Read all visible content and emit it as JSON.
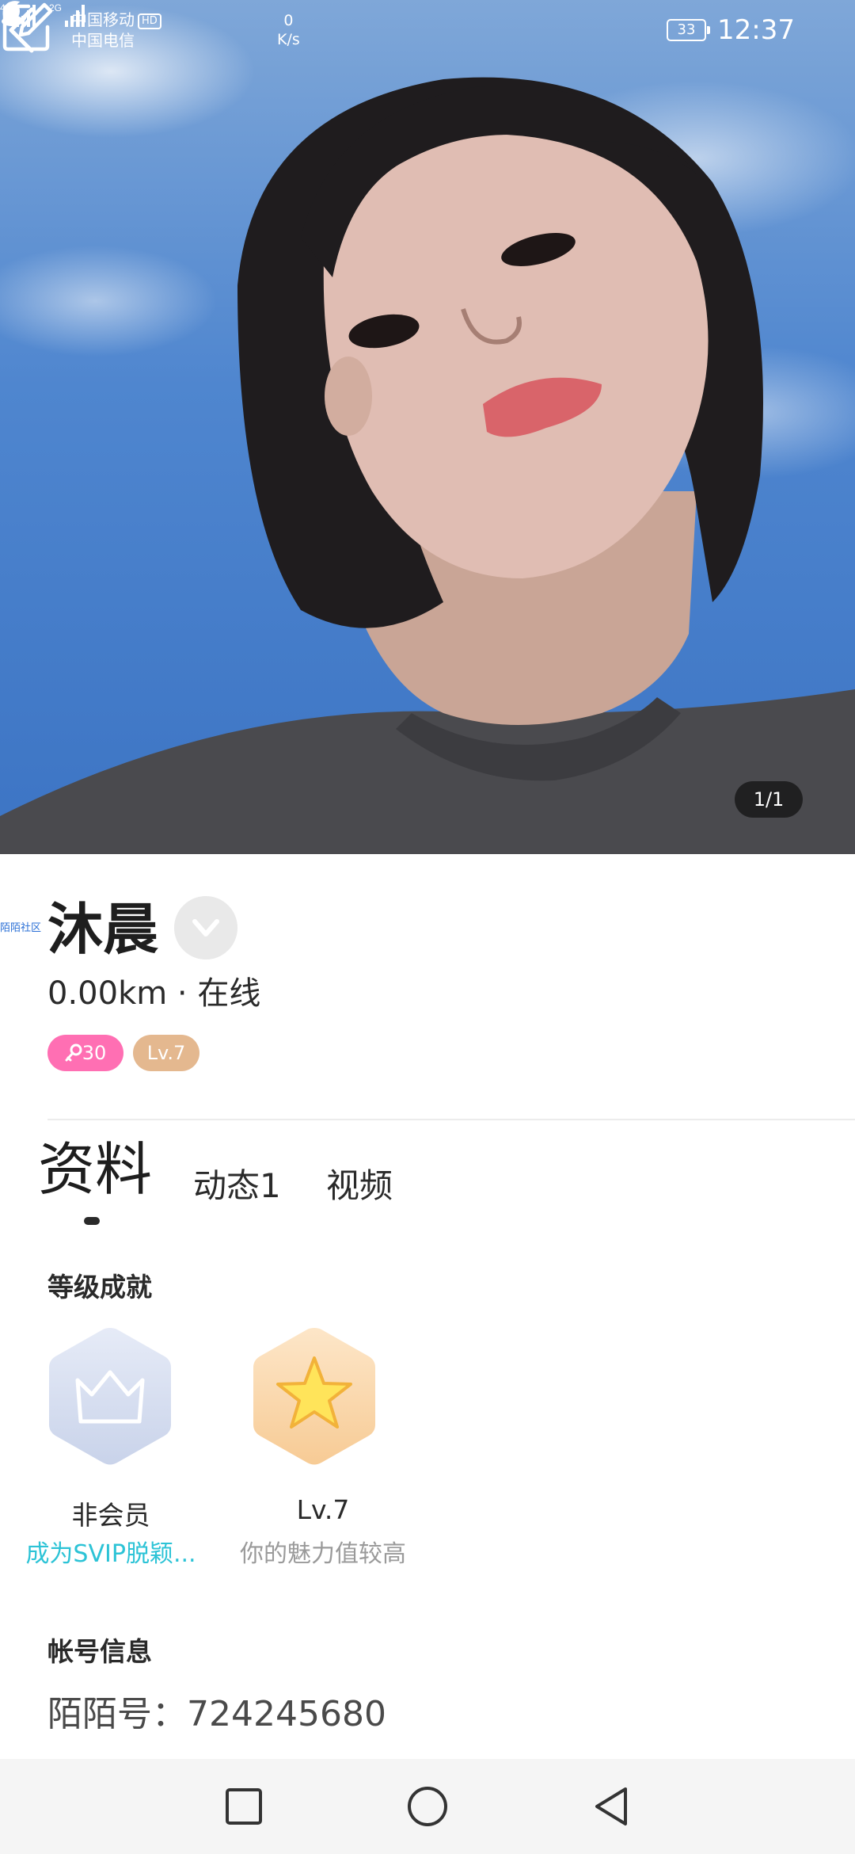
{
  "status_bar": {
    "carrier_1": "中国移动",
    "hd_badge": "HD",
    "carrier_2": "中国电信",
    "net_4g": "4G",
    "net_2g": "2G",
    "net_speed_value": "0",
    "net_speed_unit": "K/s",
    "battery": "33",
    "time": "12:37",
    "icons": [
      "signal-icon",
      "qq-icon",
      "moon-icon",
      "battery-icon"
    ]
  },
  "hero": {
    "photo_counter": "1/1",
    "icons": [
      "back-icon",
      "edit-icon"
    ]
  },
  "watermark": "陌陌社区",
  "profile": {
    "name": "沐晨",
    "distance_status": "0.00km · 在线",
    "fans_badge": "30",
    "level_badge": "Lv.7",
    "colors": {
      "fans_badge": "#ff6fb3",
      "level_badge": "#e4b88f"
    }
  },
  "tabs": [
    {
      "label": "资料",
      "active": true
    },
    {
      "label": "动态1",
      "active": false
    },
    {
      "label": "视频",
      "active": false
    }
  ],
  "achievements": {
    "title": "等级成就",
    "items": [
      {
        "title": "非会员",
        "desc": "成为SVIP脱颖...",
        "icon": "crown-icon",
        "desc_color": "#2cc3d6"
      },
      {
        "title": "Lv.7",
        "desc": "你的魅力值较高",
        "icon": "star-icon",
        "desc_color": "#9a9a9a"
      }
    ]
  },
  "account": {
    "title": "帐号信息",
    "id_text": "陌陌号：724245680"
  },
  "nav": {
    "icons": [
      "recent-apps-icon",
      "home-icon",
      "back-nav-icon"
    ]
  }
}
